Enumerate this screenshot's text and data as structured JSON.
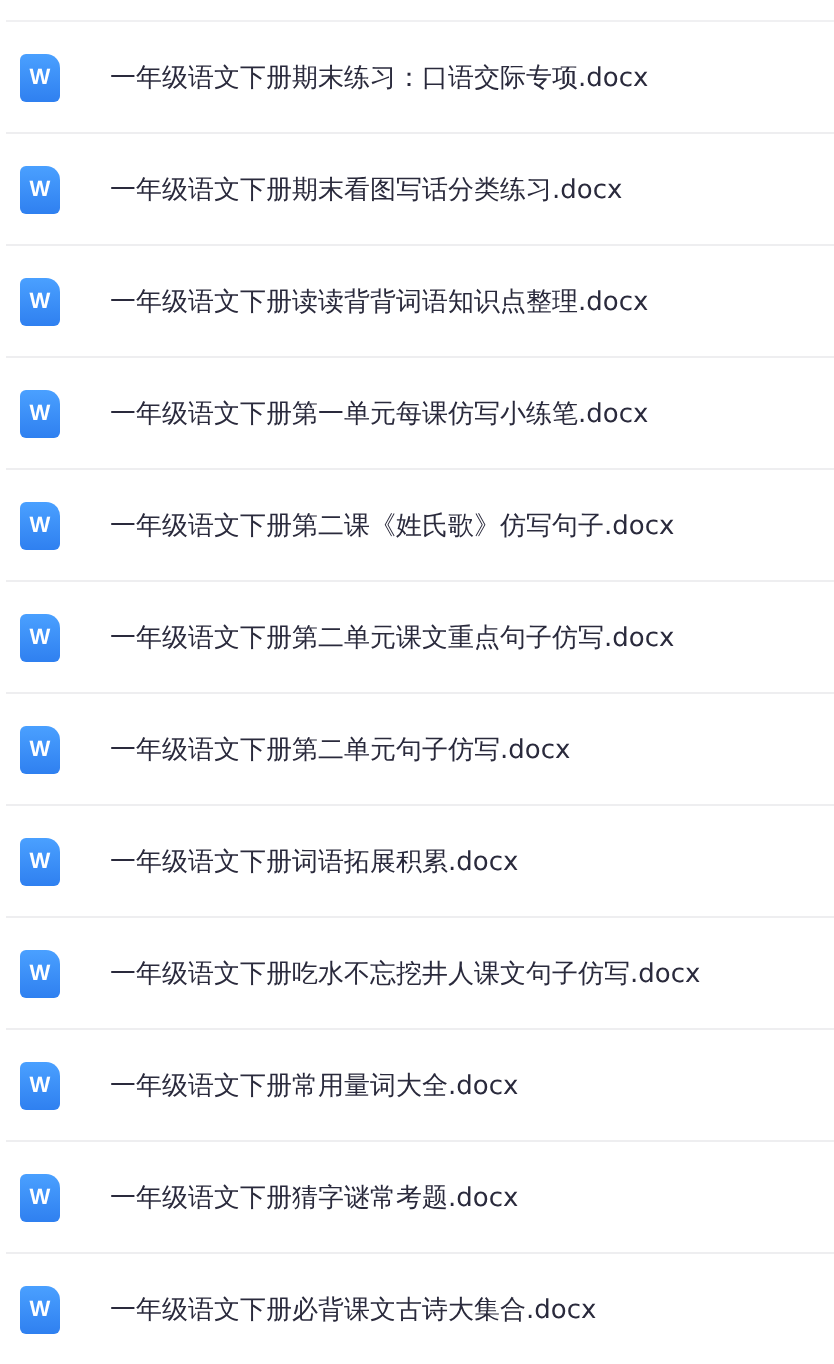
{
  "files": [
    {
      "icon_label": "W",
      "name": "一年级语文下册期末练习：口语交际专项.docx"
    },
    {
      "icon_label": "W",
      "name": "一年级语文下册期末看图写话分类练习.docx"
    },
    {
      "icon_label": "W",
      "name": "一年级语文下册读读背背词语知识点整理.docx"
    },
    {
      "icon_label": "W",
      "name": "一年级语文下册第一单元每课仿写小练笔.docx"
    },
    {
      "icon_label": "W",
      "name": "一年级语文下册第二课《姓氏歌》仿写句子.docx"
    },
    {
      "icon_label": "W",
      "name": "一年级语文下册第二单元课文重点句子仿写.docx"
    },
    {
      "icon_label": "W",
      "name": "一年级语文下册第二单元句子仿写.docx"
    },
    {
      "icon_label": "W",
      "name": "一年级语文下册词语拓展积累.docx"
    },
    {
      "icon_label": "W",
      "name": "一年级语文下册吃水不忘挖井人课文句子仿写.docx"
    },
    {
      "icon_label": "W",
      "name": "一年级语文下册常用量词大全.docx"
    },
    {
      "icon_label": "W",
      "name": "一年级语文下册猜字谜常考题.docx"
    },
    {
      "icon_label": "W",
      "name": "一年级语文下册必背课文古诗大集合.docx"
    }
  ]
}
